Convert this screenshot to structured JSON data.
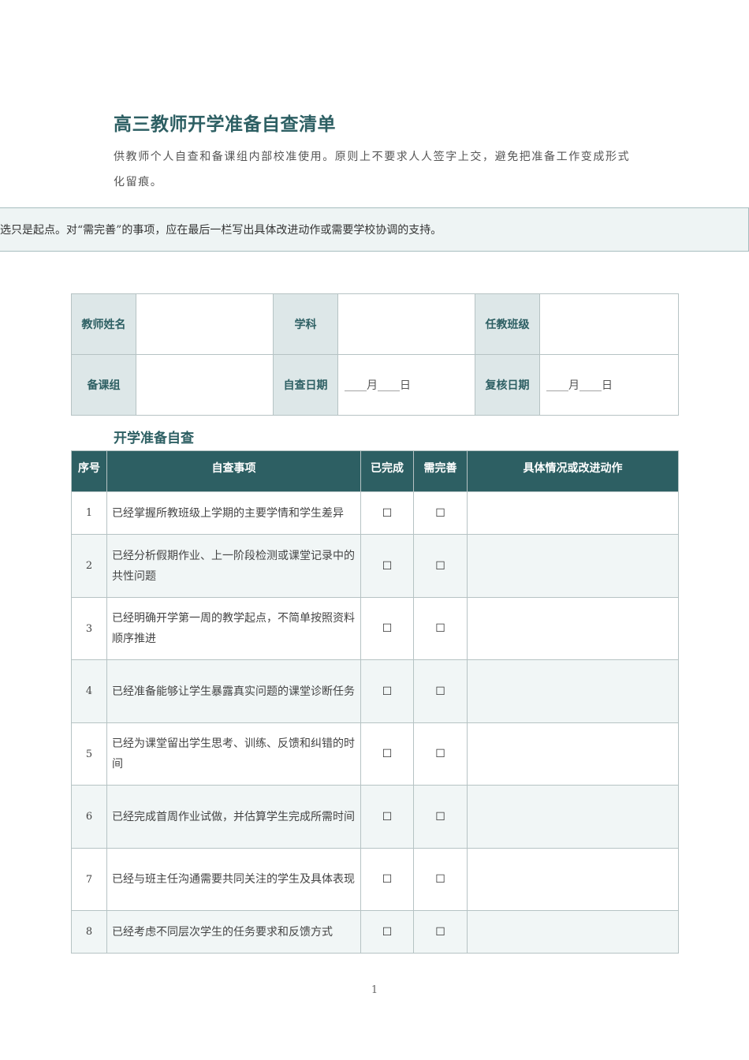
{
  "title": "高三教师开学准备自查清单",
  "intro": "供教师个人自查和备课组内部校准使用。原则上不要求人人签字上交，避免把准备工作变成形式化留痕。",
  "notice": "勾选只是起点。对“需完善”的事项，应在最后一栏写出具体改进动作或需要学校协调的支持。",
  "info": {
    "teacher_name_label": "教师姓名",
    "teacher_name_value": "",
    "subject_label": "学科",
    "subject_value": "",
    "class_label": "任教班级",
    "class_value": "",
    "group_label": "备课组",
    "group_value": "",
    "self_check_date_label": "自查日期",
    "self_check_date_value": "____月____日",
    "review_date_label": "复核日期",
    "review_date_value": "____月____日"
  },
  "section_title": "开学准备自查",
  "columns": {
    "num": "序号",
    "item": "自查事项",
    "done": "已完成",
    "improve": "需完善",
    "action": "具体情况或改进动作"
  },
  "checkbox_glyph": "☐",
  "rows": [
    {
      "num": "1",
      "item": "已经掌握所教班级上学期的主要学情和学生差异",
      "action": ""
    },
    {
      "num": "2",
      "item": "已经分析假期作业、上一阶段检测或课堂记录中的共性问题",
      "action": ""
    },
    {
      "num": "3",
      "item": "已经明确开学第一周的教学起点，不简单按照资料顺序推进",
      "action": ""
    },
    {
      "num": "4",
      "item": "已经准备能够让学生暴露真实问题的课堂诊断任务",
      "action": ""
    },
    {
      "num": "5",
      "item": "已经为课堂留出学生思考、训练、反馈和纠错的时间",
      "action": ""
    },
    {
      "num": "6",
      "item": "已经完成首周作业试做，并估算学生完成所需时间",
      "action": ""
    },
    {
      "num": "7",
      "item": "已经与班主任沟通需要共同关注的学生及具体表现",
      "action": ""
    },
    {
      "num": "8",
      "item": "已经考虑不同层次学生的任务要求和反馈方式",
      "action": ""
    }
  ],
  "page_number": "1"
}
